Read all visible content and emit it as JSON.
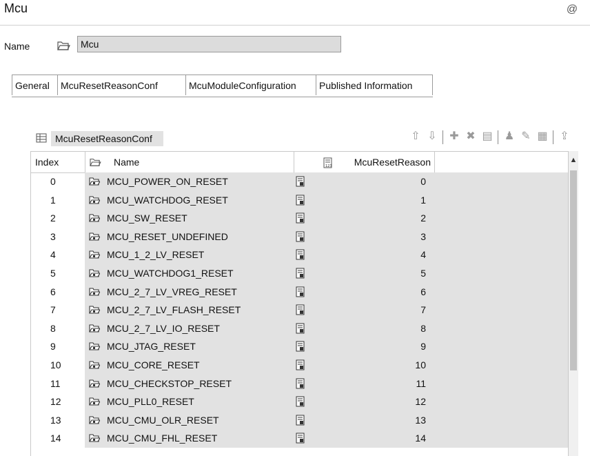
{
  "header": {
    "title": "Mcu",
    "at_icon": "@"
  },
  "name_row": {
    "label": "Name",
    "value": "Mcu"
  },
  "tabs": [
    {
      "label": "General"
    },
    {
      "label": "McuResetReasonConf"
    },
    {
      "label": "McuModuleConfiguration"
    },
    {
      "label": "Published Information"
    }
  ],
  "table": {
    "title": "McuResetReasonConf",
    "columns": {
      "index": "Index",
      "name": "Name",
      "reason": "McuResetReason"
    },
    "rows": [
      {
        "index": "0",
        "name": "MCU_POWER_ON_RESET",
        "reason": "0"
      },
      {
        "index": "1",
        "name": "MCU_WATCHDOG_RESET",
        "reason": "1"
      },
      {
        "index": "2",
        "name": "MCU_SW_RESET",
        "reason": "2"
      },
      {
        "index": "3",
        "name": "MCU_RESET_UNDEFINED",
        "reason": "3"
      },
      {
        "index": "4",
        "name": "MCU_1_2_LV_RESET",
        "reason": "4"
      },
      {
        "index": "5",
        "name": "MCU_WATCHDOG1_RESET",
        "reason": "5"
      },
      {
        "index": "6",
        "name": "MCU_2_7_LV_VREG_RESET",
        "reason": "6"
      },
      {
        "index": "7",
        "name": "MCU_2_7_LV_FLASH_RESET",
        "reason": "7"
      },
      {
        "index": "8",
        "name": "MCU_2_7_LV_IO_RESET",
        "reason": "8"
      },
      {
        "index": "9",
        "name": "MCU_JTAG_RESET",
        "reason": "9"
      },
      {
        "index": "10",
        "name": "MCU_CORE_RESET",
        "reason": "10"
      },
      {
        "index": "11",
        "name": "MCU_CHECKSTOP_RESET",
        "reason": "11"
      },
      {
        "index": "12",
        "name": "MCU_PLL0_RESET",
        "reason": "12"
      },
      {
        "index": "13",
        "name": "MCU_CMU_OLR_RESET",
        "reason": "13"
      },
      {
        "index": "14",
        "name": "MCU_CMU_FHL_RESET",
        "reason": "14"
      }
    ]
  },
  "toolbar_icons": [
    "move-up-icon",
    "move-down-icon",
    "add-icon",
    "delete-icon",
    "copy-icon",
    "user-icon",
    "edit-icon",
    "form-icon",
    "import-icon"
  ]
}
